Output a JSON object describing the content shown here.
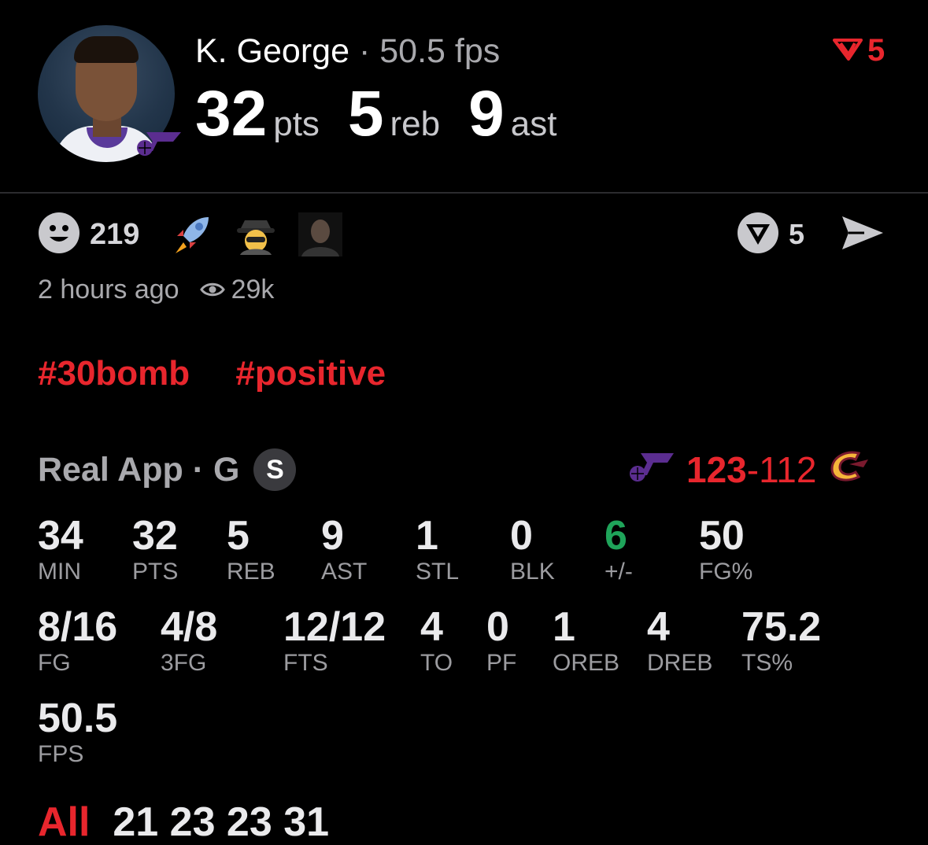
{
  "colors": {
    "accent": "#e8262d",
    "positive": "#1fa45a",
    "muted": "#a9a9ad",
    "jazz_purple": "#5b2d90"
  },
  "header": {
    "player_name": "K. George",
    "separator": "·",
    "fps_text": "50.5 fps",
    "stats": [
      {
        "value": "32",
        "unit": "pts"
      },
      {
        "value": "5",
        "unit": "reb"
      },
      {
        "value": "9",
        "unit": "ast"
      }
    ],
    "corner_icon": "red-v-logo-icon",
    "corner_count": "5"
  },
  "reactions": {
    "smiley_icon": "smiley-icon",
    "count": "219",
    "emojis": [
      "rocket-emoji",
      "detective-emoji",
      "dark-face-emoji"
    ],
    "share_icon": "v-circle-icon",
    "share_count": "5",
    "send_icon": "send-icon"
  },
  "meta": {
    "time": "2 hours ago",
    "views": "29k",
    "eye_icon": "eye-icon"
  },
  "tags": [
    "#30bomb",
    "#positive"
  ],
  "source": {
    "label": "Real App",
    "sep": "·",
    "position": "G",
    "badge": "S"
  },
  "score": {
    "home": "123",
    "dash": "-",
    "away": "112",
    "home_team_icon": "jazz-logo-icon",
    "away_team_icon": "cavaliers-logo-icon"
  },
  "stats_row1": [
    {
      "value": "34",
      "label": "MIN"
    },
    {
      "value": "32",
      "label": "PTS"
    },
    {
      "value": "5",
      "label": "REB"
    },
    {
      "value": "9",
      "label": "AST"
    },
    {
      "value": "1",
      "label": "STL"
    },
    {
      "value": "0",
      "label": "BLK"
    },
    {
      "value": "6",
      "label": "+/-"
    },
    {
      "value": "50",
      "label": "FG%"
    }
  ],
  "stats_row2": [
    {
      "value": "8/16",
      "label": "FG"
    },
    {
      "value": "4/8",
      "label": "3FG"
    },
    {
      "value": "12/12",
      "label": "FTS"
    },
    {
      "value": "4",
      "label": "TO"
    },
    {
      "value": "0",
      "label": "PF"
    },
    {
      "value": "1",
      "label": "OREB"
    },
    {
      "value": "4",
      "label": "DREB"
    },
    {
      "value": "75.2",
      "label": "TS%"
    }
  ],
  "stats_row3": [
    {
      "value": "50.5",
      "label": "FPS"
    }
  ],
  "cut_off_row": {
    "prefix": "All",
    "values": "21  23  23  31"
  }
}
